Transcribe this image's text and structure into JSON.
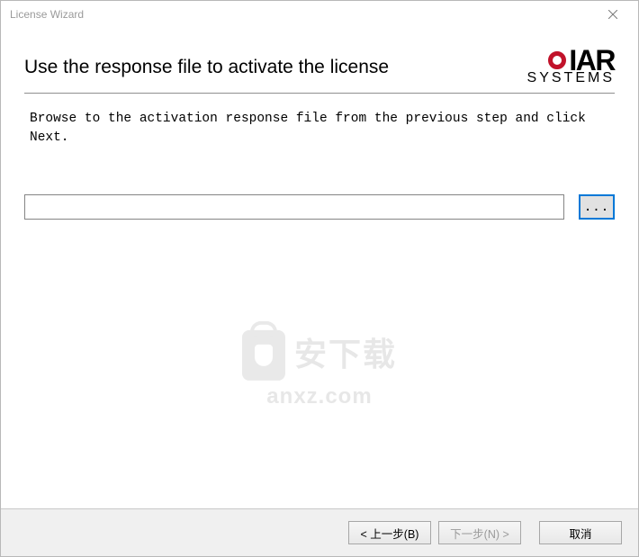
{
  "window": {
    "title": "License Wizard"
  },
  "page": {
    "heading": "Use the response file to activate the license",
    "instruction": "Browse to the activation response file from the previous step and click Next."
  },
  "logo": {
    "brand": "IAR",
    "subtitle": "SYSTEMS"
  },
  "form": {
    "path_value": "",
    "browse_label": "..."
  },
  "watermark": {
    "cn": "安下载",
    "en": "anxz.com"
  },
  "buttons": {
    "back": "< 上一步(B)",
    "next": "下一步(N) >",
    "cancel": "取消"
  }
}
